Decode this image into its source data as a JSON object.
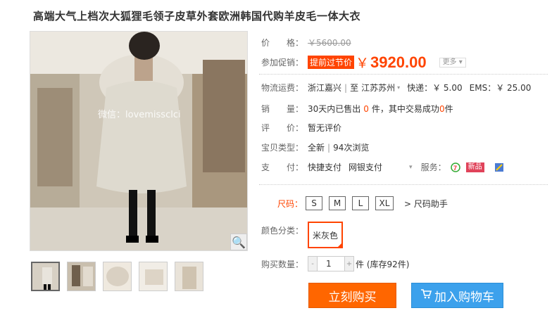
{
  "product": {
    "title": "高端大气上档次大狐狸毛领子皮草外套欧洲韩国代购羊皮毛一体大衣",
    "watermark": "微信：lovemissclci"
  },
  "price": {
    "label": "价　　格：",
    "original": "￥5600.00"
  },
  "promo": {
    "label": "参加促销：",
    "badge": "提前过节价",
    "currency": "￥",
    "value": "3920.00",
    "more": "更多 ▾"
  },
  "shipping": {
    "label": "物流运费：",
    "from": "浙江嘉兴",
    "sep": "|",
    "to_label": "至",
    "to": "江苏苏州",
    "caret": "▾",
    "express": "快递：￥ 5.00",
    "ems": "EMS：￥ 25.00"
  },
  "sales": {
    "label": "销　　量：",
    "pre": "30天内已售出",
    "count": "0",
    "mid": "件，其中交易成功",
    "success": "0",
    "post": "件"
  },
  "review": {
    "label": "评　　价：",
    "value": "暂无评价"
  },
  "type": {
    "label": "宝贝类型：",
    "value": "全新",
    "sep": "|",
    "views": "94次浏览"
  },
  "payment": {
    "label": "支　　付：",
    "method1": "快捷支付",
    "method2": "网银支付",
    "service_label": "服务：",
    "service_tag": "新品"
  },
  "size": {
    "label": "尺码：",
    "options": [
      "S",
      "M",
      "L",
      "XL"
    ],
    "helper": "> 尺码助手"
  },
  "color": {
    "label": "颜色分类：",
    "selected": "米灰色"
  },
  "quantity": {
    "label": "购买数量：",
    "minus": "-",
    "value": "1",
    "plus": "+",
    "stock": "件 (库存92件)"
  },
  "actions": {
    "buy": "立刻购买",
    "cart": "加入购物车"
  },
  "colors": {
    "accent": "#ff4400",
    "buy_bg": "#ff6600",
    "cart_bg": "#3ca1ec"
  }
}
